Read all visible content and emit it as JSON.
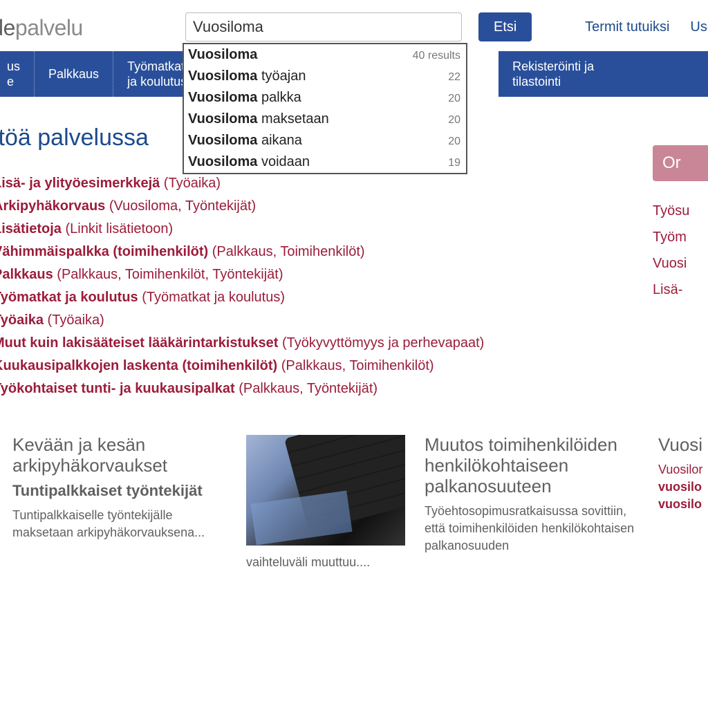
{
  "logo": {
    "bold": "hde",
    "light": "palvelu"
  },
  "search": {
    "value": "Vuosiloma",
    "button": "Etsi"
  },
  "top_links": {
    "termit": "Termit tutuiksi",
    "use": "Use"
  },
  "nav": {
    "item1a": "us",
    "item1b": "e",
    "item2": "Palkkaus",
    "item3a": "Työmatkat",
    "item3b": "ja koulutus",
    "item4a": "Rekisteröinti ja",
    "item4b": "tilastointi"
  },
  "autocomplete": [
    {
      "bold": "Vuosiloma",
      "rest": "",
      "count": "40 results"
    },
    {
      "bold": "Vuosiloma",
      "rest": " työajan",
      "count": "22"
    },
    {
      "bold": "Vuosiloma",
      "rest": " palkka",
      "count": "20"
    },
    {
      "bold": "Vuosiloma",
      "rest": " maksetaan",
      "count": "20"
    },
    {
      "bold": "Vuosiloma",
      "rest": " aikana",
      "count": "20"
    },
    {
      "bold": "Vuosiloma",
      "rest": " voidaan",
      "count": "19"
    }
  ],
  "page_title": "ltöä palvelussa",
  "list": [
    {
      "title": "Lisä- ja ylityöesimerkkejä",
      "cat": " (Työaika)"
    },
    {
      "title": "Arkipyhäkorvaus",
      "cat": " (Vuosiloma, Työntekijät)"
    },
    {
      "title": "Lisätietoja",
      "cat": " (Linkit lisätietoon)"
    },
    {
      "title": "Vähimmäispalkka (toimihenkilöt)",
      "cat": " (Palkkaus, Toimihenkilöt)"
    },
    {
      "title": "Palkkaus",
      "cat": " (Palkkaus, Toimihenkilöt, Työntekijät)"
    },
    {
      "title": "Työmatkat ja koulutus",
      "cat": " (Työmatkat ja koulutus)"
    },
    {
      "title": "Työaika",
      "cat": " (Työaika)"
    },
    {
      "title": "Muut kuin lakisääteiset lääkärintarkistukset",
      "cat": " (Työkyvyttömyys ja perhevapaat)"
    },
    {
      "title": "Kuukausipalkkojen laskenta (toimihenkilöt)",
      "cat": " (Palkkaus, Toimihenkilöt)"
    },
    {
      "title": "Työkohtaiset tunti- ja kuukausipalkat",
      "cat": " (Palkkaus, Työntekijät)"
    }
  ],
  "sidebar": {
    "pink": "Or",
    "links": [
      "Työsu",
      "Työm",
      "Vuosi",
      "Lisä- "
    ]
  },
  "articles": {
    "a1": {
      "h3": "Kevään ja kesän arkipyhäkorvaukset",
      "h4": "Tuntipalkkaiset työntekijät",
      "p": "Tuntipalkkaiselle työntekijälle maksetaan arkipyhäkorvauksena..."
    },
    "img_caption": "vaihteluväli muuttuu....",
    "a2": {
      "h3": "Muutos toimihenkilöiden henkilökohtaiseen palkanosuuteen",
      "p": "Työehtosopimusratkaisussa sovittiin, että toimihenkilöiden henkilökohtaisen palkanosuuden"
    },
    "a3": {
      "h3": "Vuosi",
      "p1": "Vuosilor",
      "b1": "vuosilo",
      "b2": "vuosilo"
    }
  }
}
